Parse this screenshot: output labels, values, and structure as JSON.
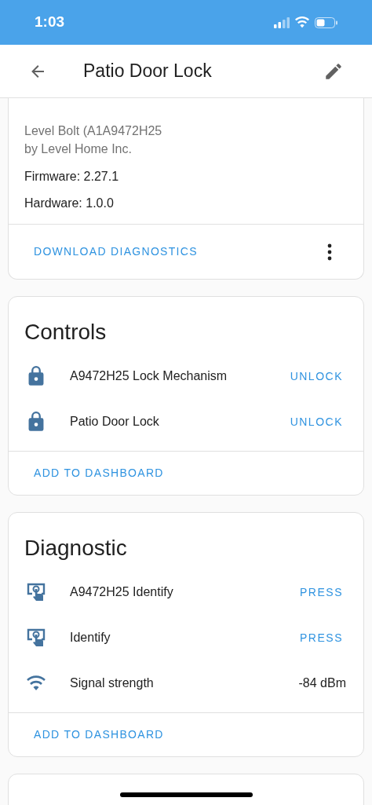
{
  "status_bar": {
    "time": "1:03"
  },
  "app_bar": {
    "title": "Patio Door Lock"
  },
  "device_info": {
    "model_lines": [
      "Level Bolt (A1A9472H25",
      "by Level Home Inc."
    ],
    "details": [
      "Firmware: 2.27.1",
      "Hardware: 1.0.0"
    ],
    "action": "DOWNLOAD DIAGNOSTICS"
  },
  "sections": [
    {
      "title": "Controls",
      "rows": [
        {
          "kind": "lock",
          "name": "A9472H25 Lock Mechanism",
          "action": "UNLOCK"
        },
        {
          "kind": "lock",
          "name": "Patio Door Lock",
          "action": "UNLOCK"
        }
      ],
      "footer": "ADD TO DASHBOARD"
    },
    {
      "title": "Diagnostic",
      "rows": [
        {
          "kind": "identify",
          "name": "A9472H25 Identify",
          "action": "PRESS"
        },
        {
          "kind": "identify",
          "name": "Identify",
          "action": "PRESS"
        },
        {
          "kind": "signal",
          "name": "Signal strength",
          "value": "-84 dBm"
        }
      ],
      "footer": "ADD TO DASHBOARD"
    }
  ]
}
